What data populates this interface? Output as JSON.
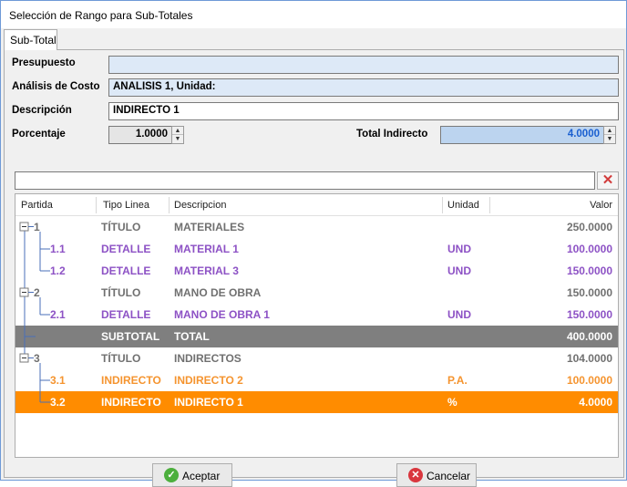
{
  "window": {
    "title": "Selección de Rango para Sub-Totales"
  },
  "tab": {
    "label": "Sub-Total"
  },
  "form": {
    "presupuesto_label": "Presupuesto",
    "presupuesto_value": "",
    "analisis_label": "Análisis de Costo",
    "analisis_value": "ANALISIS 1, Unidad:",
    "descripcion_label": "Descripción",
    "descripcion_value": "INDIRECTO 1",
    "porcentaje_label": "Porcentaje",
    "porcentaje_value": "1.0000",
    "total_label": "Total Indirecto",
    "total_value": "4.0000"
  },
  "filter": {
    "value": ""
  },
  "grid": {
    "columns": [
      "Partida",
      "Tipo Linea",
      "Descripcion",
      "Unidad",
      "Valor"
    ],
    "rows": [
      {
        "partida": "1",
        "tipo": "TÍTULO",
        "descripcion": "MATERIALES",
        "unidad": "",
        "valor": "250.0000",
        "style": "titulo"
      },
      {
        "partida": "1.1",
        "tipo": "DETALLE",
        "descripcion": "MATERIAL 1",
        "unidad": "UND",
        "valor": "100.0000",
        "style": "detalle"
      },
      {
        "partida": "1.2",
        "tipo": "DETALLE",
        "descripcion": "MATERIAL 3",
        "unidad": "UND",
        "valor": "150.0000",
        "style": "detalle"
      },
      {
        "partida": "2",
        "tipo": "TÍTULO",
        "descripcion": "MANO DE OBRA",
        "unidad": "",
        "valor": "150.0000",
        "style": "titulo"
      },
      {
        "partida": "2.1",
        "tipo": "DETALLE",
        "descripcion": "MANO DE OBRA 1",
        "unidad": "UND",
        "valor": "150.0000",
        "style": "detalle"
      },
      {
        "partida": "",
        "tipo": "SUBTOTAL",
        "descripcion": "TOTAL",
        "unidad": "",
        "valor": "400.0000",
        "style": "subtotal"
      },
      {
        "partida": "3",
        "tipo": "TÍTULO",
        "descripcion": "INDIRECTOS",
        "unidad": "",
        "valor": "104.0000",
        "style": "titulo"
      },
      {
        "partida": "3.1",
        "tipo": "INDIRECTO",
        "descripcion": "INDIRECTO 2",
        "unidad": "P.A.",
        "valor": "100.0000",
        "style": "indirecto"
      },
      {
        "partida": "3.2",
        "tipo": "INDIRECTO",
        "descripcion": "INDIRECTO 1",
        "unidad": "%",
        "valor": "4.0000",
        "style": "selected"
      }
    ]
  },
  "buttons": {
    "accept": "Aceptar",
    "cancel": "Cancelar"
  },
  "colors": {
    "titulo": "#707070",
    "detalle": "#8d52c5",
    "subtotal_bg": "#7f7f7f",
    "indirecto": "#f5942f",
    "selected_bg": "#ff8c00",
    "filter_blue": "#bcd4ef"
  }
}
